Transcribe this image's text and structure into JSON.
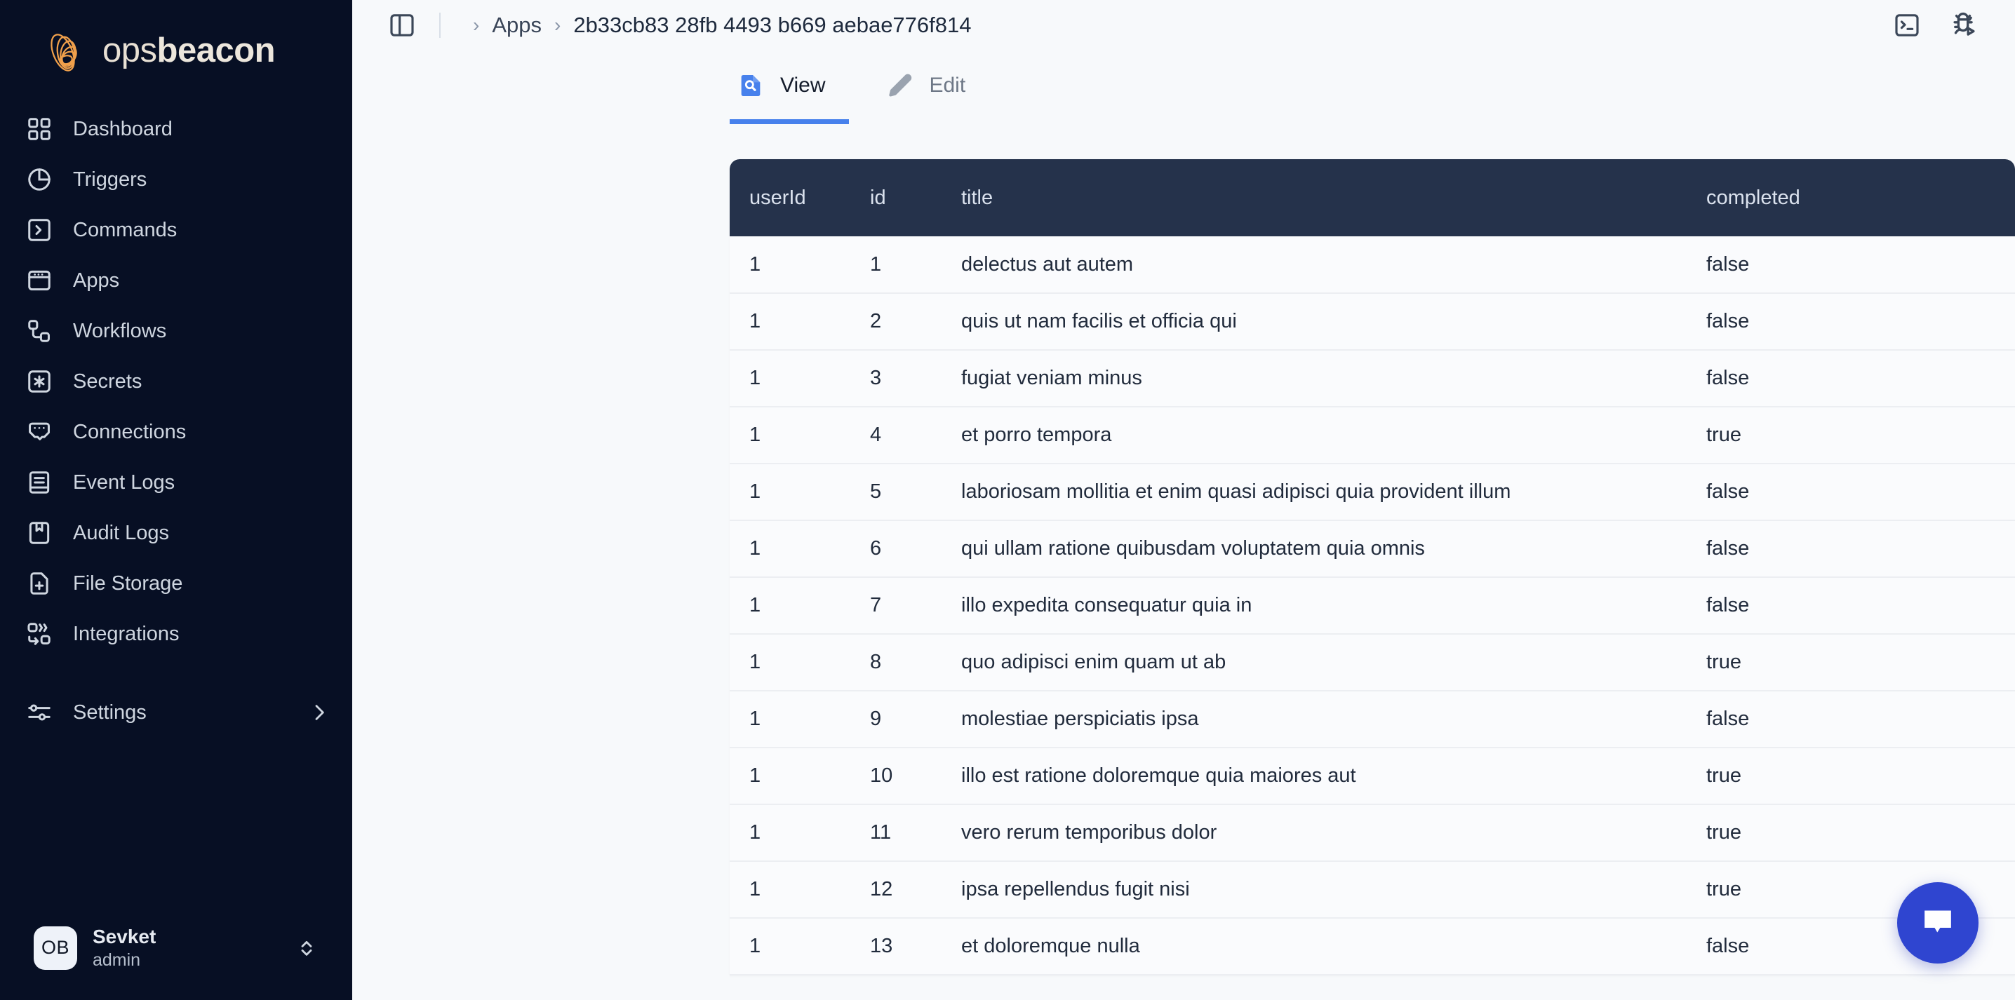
{
  "brand": {
    "logo_icon": "opsbeacon-spiral-logo-icon",
    "name_light": "ops",
    "name_bold": "beacon",
    "logo_color": "#f0a04b",
    "sidebar_bg": "#070f24"
  },
  "sidebar": {
    "items": [
      {
        "label": "Dashboard",
        "icon": "grid-icon"
      },
      {
        "label": "Triggers",
        "icon": "pie-chart-icon"
      },
      {
        "label": "Commands",
        "icon": "terminal-chevron-icon"
      },
      {
        "label": "Apps",
        "icon": "window-dots-icon"
      },
      {
        "label": "Workflows",
        "icon": "workflow-nodes-icon"
      },
      {
        "label": "Secrets",
        "icon": "asterisk-square-icon"
      },
      {
        "label": "Connections",
        "icon": "plug-socket-icon"
      },
      {
        "label": "Event Logs",
        "icon": "document-lines-icon"
      },
      {
        "label": "Audit Logs",
        "icon": "bookmark-book-icon"
      },
      {
        "label": "File Storage",
        "icon": "file-plus-icon"
      },
      {
        "label": "Integrations",
        "icon": "integrations-nodes-icon"
      }
    ],
    "settings": {
      "label": "Settings",
      "icon": "sliders-icon",
      "chevron": "chevron-right-icon"
    },
    "user": {
      "initials": "OB",
      "name": "Sevket",
      "role": "admin",
      "switch_icon": "chevron-up-down-icon"
    }
  },
  "topbar": {
    "panel_toggle_icon": "sidebar-panel-toggle-icon",
    "breadcrumbs": [
      {
        "label": "Apps"
      },
      {
        "label": "2b33cb83 28fb 4493 b669 aebae776f814"
      }
    ],
    "separator": "›",
    "actions": [
      {
        "icon": "terminal-icon"
      },
      {
        "icon": "bug-play-debug-icon"
      }
    ]
  },
  "tabs": [
    {
      "label": "View",
      "icon": "document-search-icon",
      "active": true
    },
    {
      "label": "Edit",
      "icon": "pencil-icon",
      "active": false
    }
  ],
  "accent": {
    "tab_active": "#4781ec",
    "table_header_bg": "#25324b",
    "fab": "#2f45d0"
  },
  "table": {
    "columns": [
      "userId",
      "id",
      "title",
      "completed"
    ],
    "rows": [
      {
        "userId": "1",
        "id": "1",
        "title": "delectus aut autem",
        "completed": "false"
      },
      {
        "userId": "1",
        "id": "2",
        "title": "quis ut nam facilis et officia qui",
        "completed": "false"
      },
      {
        "userId": "1",
        "id": "3",
        "title": "fugiat veniam minus",
        "completed": "false"
      },
      {
        "userId": "1",
        "id": "4",
        "title": "et porro tempora",
        "completed": "true"
      },
      {
        "userId": "1",
        "id": "5",
        "title": "laboriosam mollitia et enim quasi adipisci quia provident illum",
        "completed": "false"
      },
      {
        "userId": "1",
        "id": "6",
        "title": "qui ullam ratione quibusdam voluptatem quia omnis",
        "completed": "false"
      },
      {
        "userId": "1",
        "id": "7",
        "title": "illo expedita consequatur quia in",
        "completed": "false"
      },
      {
        "userId": "1",
        "id": "8",
        "title": "quo adipisci enim quam ut ab",
        "completed": "true"
      },
      {
        "userId": "1",
        "id": "9",
        "title": "molestiae perspiciatis ipsa",
        "completed": "false"
      },
      {
        "userId": "1",
        "id": "10",
        "title": "illo est ratione doloremque quia maiores aut",
        "completed": "true"
      },
      {
        "userId": "1",
        "id": "11",
        "title": "vero rerum temporibus dolor",
        "completed": "true"
      },
      {
        "userId": "1",
        "id": "12",
        "title": "ipsa repellendus fugit nisi",
        "completed": "true"
      },
      {
        "userId": "1",
        "id": "13",
        "title": "et doloremque nulla",
        "completed": "false"
      }
    ]
  },
  "fab": {
    "icon": "chat-bubble-icon"
  }
}
